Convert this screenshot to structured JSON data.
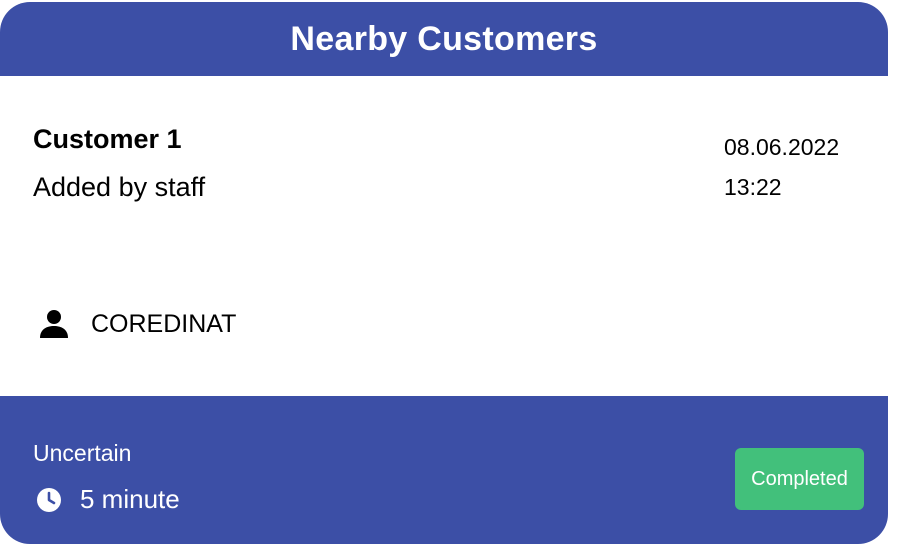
{
  "header": {
    "title": "Nearby Customers"
  },
  "customer": {
    "name": "Customer 1",
    "added_by": "Added by staff",
    "date": "08.06.2022",
    "time": "13:22",
    "contact_icon": "person-icon",
    "company": "COREDINAT"
  },
  "footer": {
    "status": "Uncertain",
    "duration_icon": "clock-icon",
    "duration": "5 minute",
    "button_label": "Completed"
  },
  "colors": {
    "header_bg": "#3c4fa6",
    "footer_bg": "#3c4fa6",
    "button_bg": "#42c07b",
    "text_light": "#ffffff",
    "text_dark": "#000000"
  }
}
